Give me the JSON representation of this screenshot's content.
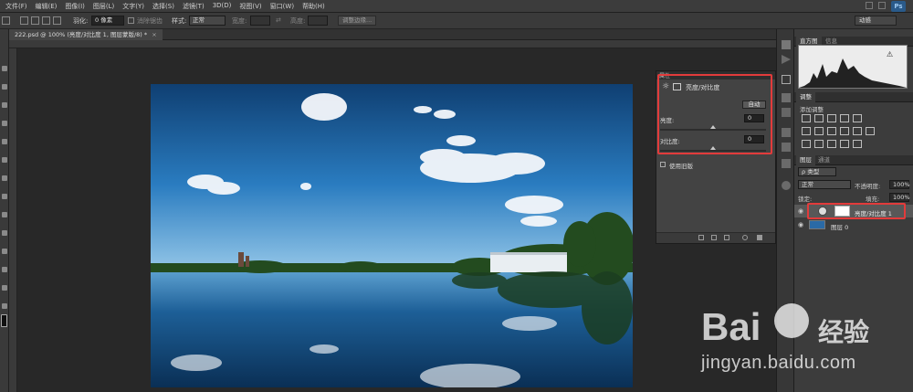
{
  "menubar": {
    "items": [
      "文件(F)",
      "编辑(E)",
      "图像(I)",
      "图层(L)",
      "文字(Y)",
      "选择(S)",
      "滤镜(T)",
      "3D(D)",
      "视图(V)",
      "窗口(W)",
      "帮助(H)"
    ],
    "ps_logo": "Ps"
  },
  "options_bar": {
    "feather_label": "羽化:",
    "feather_value": "0 像素",
    "antialias_label": "消除锯齿",
    "style_label": "样式:",
    "style_value": "正常",
    "width_label": "宽度:",
    "height_label": "高度:",
    "refine_edge": "调整边缘...",
    "workspace": "动感"
  },
  "document": {
    "tab_title": "222.psd @ 100% (亮度/对比度 1, 图层蒙版/8) *",
    "close_glyph": "×"
  },
  "panels": {
    "histogram_tabs": [
      "直方图",
      "信息"
    ],
    "adjustments_tabs": [
      "调整"
    ],
    "adjustments_subtitle": "添加调整",
    "layers_tabs": [
      "图层",
      "通道"
    ],
    "kind_filter": "ρ 类型",
    "blend_mode": "正常",
    "opacity_label": "不透明度:",
    "opacity_value": "100%",
    "lock_label": "锁定:",
    "fill_label": "填充:",
    "fill_value": "100%",
    "layers": [
      {
        "name": "亮度/对比度 1",
        "type": "adjustment"
      },
      {
        "name": "图层 0",
        "type": "pixel"
      }
    ]
  },
  "properties": {
    "tab": "属性",
    "title": "亮度/对比度",
    "auto_button": "自动",
    "brightness_label": "亮度:",
    "brightness_value": "0",
    "contrast_label": "对比度:",
    "contrast_value": "0",
    "legacy_label": "使用旧版",
    "brightness_level": 0.5,
    "contrast_level": 0.5
  },
  "watermark": {
    "brand": "Bai",
    "brand2": "经验",
    "url": "jingyan.baidu.com"
  },
  "colors": {
    "highlight_red": "#e23b3b",
    "panel_bg": "#3c3c3c",
    "sky_top": "#0f3f72",
    "water": "#0d4374"
  }
}
